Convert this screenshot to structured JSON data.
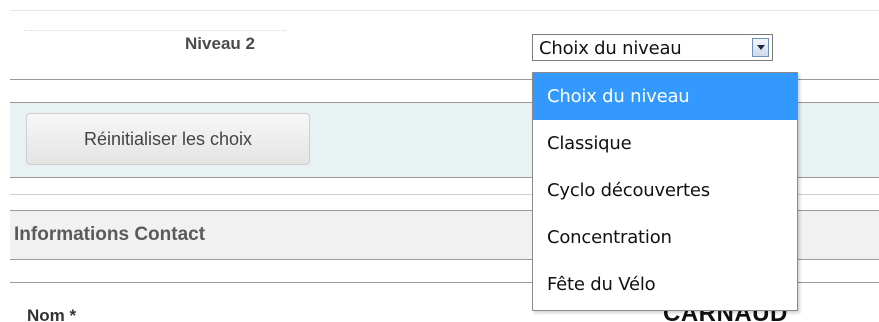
{
  "level_row": {
    "label": "Niveau 2",
    "select": {
      "value": "Choix du niveau",
      "options": [
        "Choix du niveau",
        "Classique",
        "Cyclo découvertes",
        "Concentration",
        "Fête du Vélo"
      ],
      "highlighted_index": 0
    }
  },
  "reset": {
    "button_label": "Réinitialiser les choix"
  },
  "contact_section": {
    "title": "Informations Contact",
    "name_label": "Nom *",
    "partial_text": "CARNAUD"
  },
  "colors": {
    "highlight": "#3399ff",
    "reset_band": "#e9f2f2",
    "section_band": "#f1f1f1"
  },
  "icons": {
    "select_arrow": "chevron-down-icon"
  }
}
